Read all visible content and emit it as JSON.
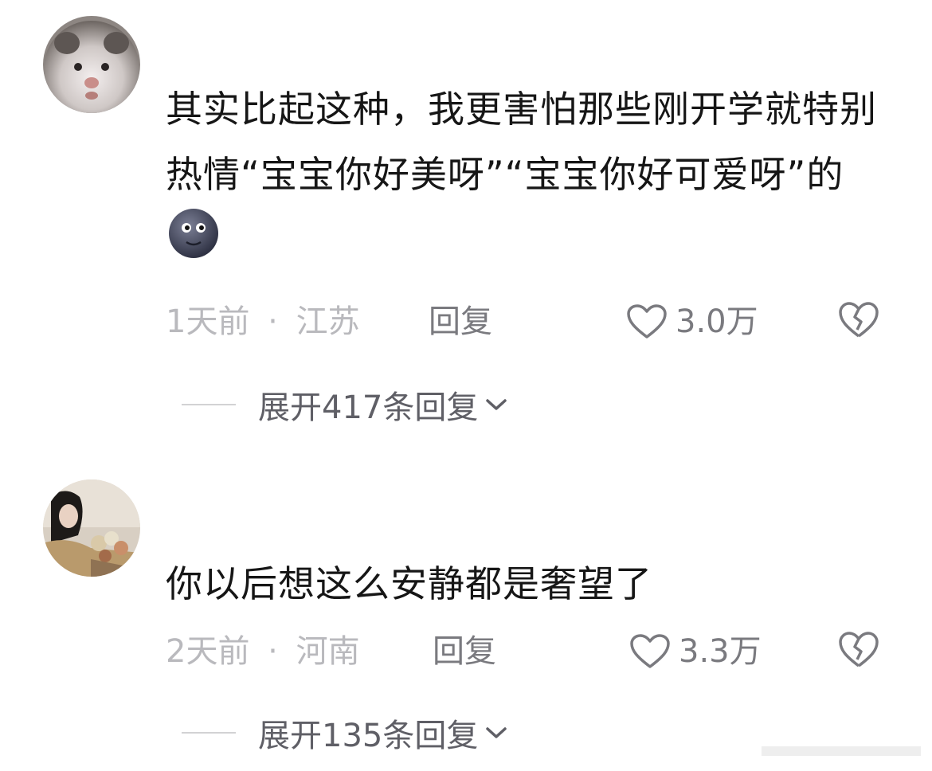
{
  "comments": [
    {
      "text": "其实比起这种，我更害怕那些刚开学就特别热情“宝宝你好美呀”“宝宝你好可爱呀”的",
      "emoji_icon": "new-moon-face-emoji",
      "time": "1天前",
      "separator": "·",
      "location": "江苏",
      "reply_label": "回复",
      "likes": "3.0万",
      "expand_label": "展开417条回复"
    },
    {
      "text": "你以后想这么安静都是奢望了",
      "time": "2天前",
      "separator": "·",
      "location": "河南",
      "reply_label": "回复",
      "likes": "3.3万",
      "expand_label": "展开135条回复"
    }
  ],
  "colors": {
    "text": "#161616",
    "meta": "#b9b9bd",
    "action": "#7a7a7f"
  }
}
